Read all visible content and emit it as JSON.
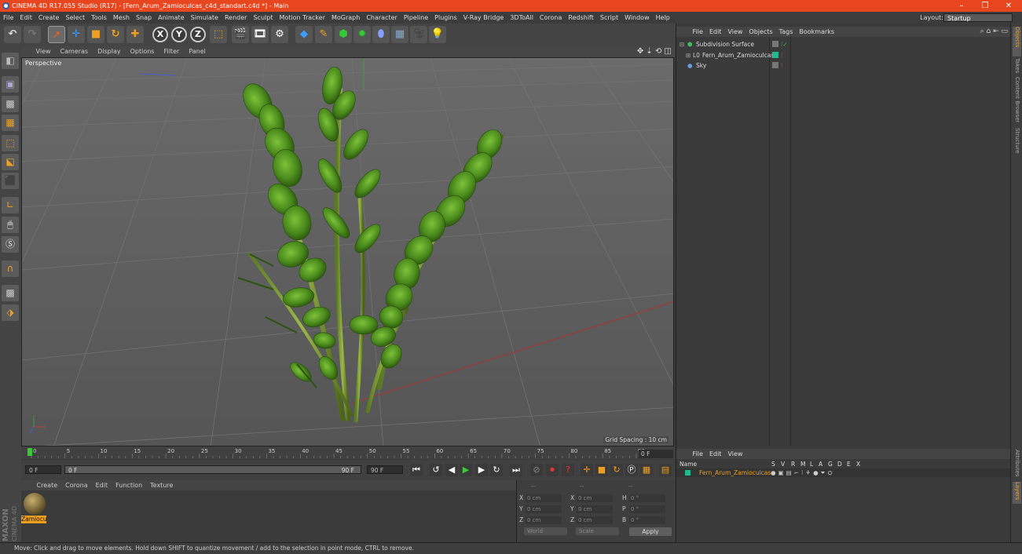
{
  "titlebar": {
    "title": "CINEMA 4D R17.055 Studio (R17) - [Fern_Arum_Zamioculcas_c4d_standart.c4d *] - Main",
    "minimize": "–",
    "restore": "❐",
    "close": "✕"
  },
  "menubar": {
    "items": [
      "File",
      "Edit",
      "Create",
      "Select",
      "Tools",
      "Mesh",
      "Snap",
      "Animate",
      "Simulate",
      "Render",
      "Sculpt",
      "Motion Tracker",
      "MoGraph",
      "Character",
      "Pipeline",
      "Plugins",
      "V-Ray Bridge",
      "3DToAll",
      "Corona",
      "Redshift",
      "Script",
      "Window",
      "Help"
    ],
    "layout_label": "Layout:",
    "layout_value": "Startup"
  },
  "toolbar": {
    "x_label": "X",
    "y_label": "Y",
    "z_label": "Z"
  },
  "viewport": {
    "menu": [
      "View",
      "Cameras",
      "Display",
      "Options",
      "Filter",
      "Panel"
    ],
    "label": "Perspective",
    "grid_spacing": "Grid Spacing : 10 cm"
  },
  "timeline": {
    "ticks": [
      "0",
      "5",
      "10",
      "15",
      "20",
      "25",
      "30",
      "35",
      "40",
      "45",
      "50",
      "55",
      "60",
      "65",
      "70",
      "75",
      "80",
      "85",
      "90"
    ],
    "end_frame": "0 F",
    "start_field": "0 F",
    "scrub_start": "0 F",
    "scrub_end": "90 F",
    "max_field": "90 F"
  },
  "materials": {
    "menu": [
      "Create",
      "Corona",
      "Edit",
      "Function",
      "Texture"
    ],
    "items": [
      {
        "label": "Zamiocu"
      }
    ],
    "brand_top": "MAXON",
    "brand_bottom": "CINEMA 4D"
  },
  "coordinates": {
    "header": [
      "--",
      "--",
      "--"
    ],
    "rows": [
      {
        "a": "X",
        "av": "0 cm",
        "b": "X",
        "bv": "0 cm",
        "c": "H",
        "cv": "0 °"
      },
      {
        "a": "Y",
        "av": "0 cm",
        "b": "Y",
        "bv": "0 cm",
        "c": "P",
        "cv": "0 °"
      },
      {
        "a": "Z",
        "av": "0 cm",
        "b": "Z",
        "bv": "0 cm",
        "c": "B",
        "cv": "0 °"
      }
    ],
    "mode": "World",
    "scale": "Scale",
    "apply": "Apply"
  },
  "status": {
    "text": "Move: Click and drag to move elements. Hold down SHIFT to quantize movement / add to the selection in point mode, CTRL to remove."
  },
  "objects": {
    "menu": [
      "File",
      "Edit",
      "View",
      "Objects",
      "Tags",
      "Bookmarks"
    ],
    "items": [
      {
        "label": "Subdivision Surface",
        "color": "#44bb66"
      },
      {
        "label": "Fern_Arum_Zamioculcas",
        "color": "#22b890"
      },
      {
        "label": "Sky",
        "color": "#6aa0d8"
      }
    ]
  },
  "layers": {
    "menu": [
      "File",
      "Edit",
      "View"
    ],
    "columns": [
      "Name",
      "S",
      "V",
      "R",
      "M",
      "L",
      "A",
      "G",
      "D",
      "E",
      "X"
    ],
    "row_label": "Fern_Arum_Zamioculcas",
    "row_color": "#22b890"
  },
  "right_tabs": [
    "Objects",
    "Takes",
    "Content Browser",
    "Structure",
    "Attributes",
    "Layers"
  ]
}
